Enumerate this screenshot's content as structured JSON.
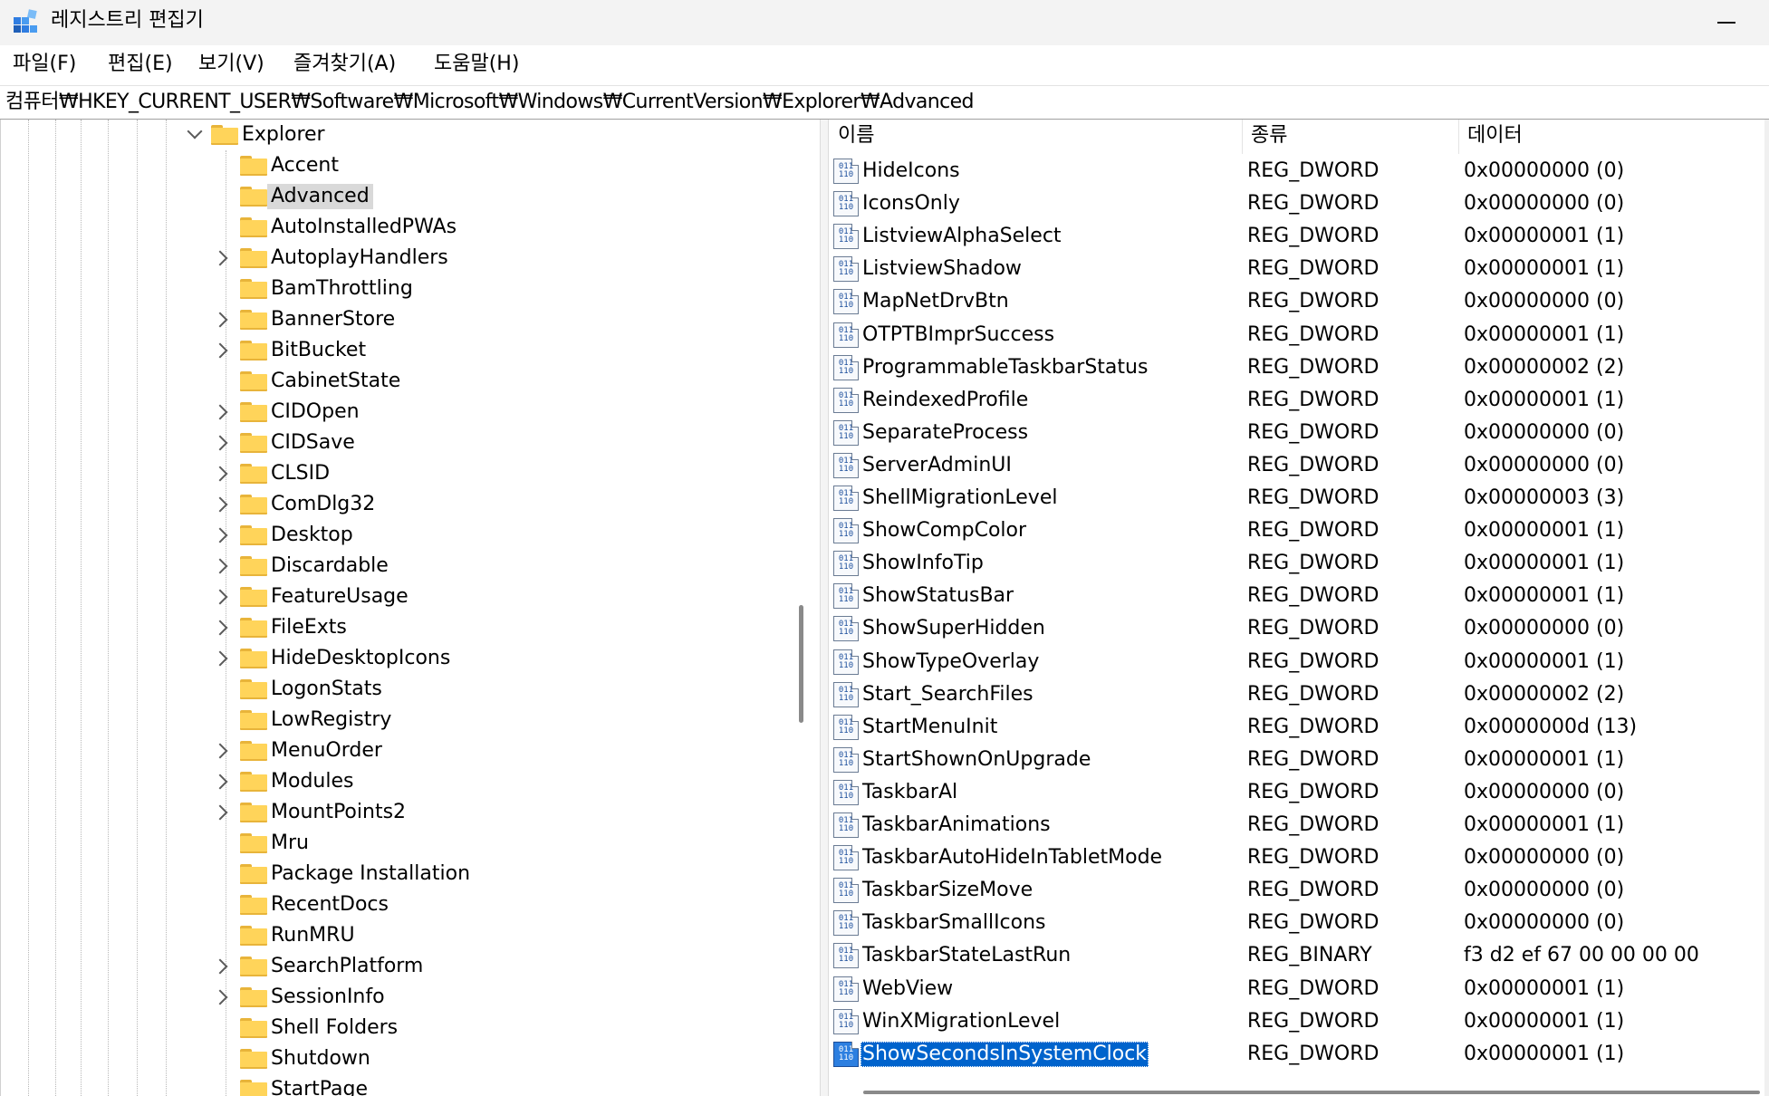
{
  "window": {
    "title": "레지스트리 편집기",
    "minimize_icon": "minimize-icon"
  },
  "menu": [
    {
      "label": "파일(F)"
    },
    {
      "label": "편집(E)"
    },
    {
      "label": "보기(V)"
    },
    {
      "label": "즐겨찾기(A)"
    },
    {
      "label": "도움말(H)"
    }
  ],
  "address": {
    "path": "컴퓨터₩HKEY_CURRENT_USER₩Software₩Microsoft₩Windows₩CurrentVersion₩Explorer₩Advanced"
  },
  "tree": {
    "parent": {
      "label": "Explorer",
      "expanded": true
    },
    "selected": "Advanced",
    "children": [
      {
        "label": "Accent",
        "has_children": false
      },
      {
        "label": "Advanced",
        "has_children": false
      },
      {
        "label": "AutoInstalledPWAs",
        "has_children": false
      },
      {
        "label": "AutoplayHandlers",
        "has_children": true
      },
      {
        "label": "BamThrottling",
        "has_children": false
      },
      {
        "label": "BannerStore",
        "has_children": true
      },
      {
        "label": "BitBucket",
        "has_children": true
      },
      {
        "label": "CabinetState",
        "has_children": false
      },
      {
        "label": "CIDOpen",
        "has_children": true
      },
      {
        "label": "CIDSave",
        "has_children": true
      },
      {
        "label": "CLSID",
        "has_children": true
      },
      {
        "label": "ComDlg32",
        "has_children": true
      },
      {
        "label": "Desktop",
        "has_children": true
      },
      {
        "label": "Discardable",
        "has_children": true
      },
      {
        "label": "FeatureUsage",
        "has_children": true
      },
      {
        "label": "FileExts",
        "has_children": true
      },
      {
        "label": "HideDesktopIcons",
        "has_children": true
      },
      {
        "label": "LogonStats",
        "has_children": false
      },
      {
        "label": "LowRegistry",
        "has_children": false
      },
      {
        "label": "MenuOrder",
        "has_children": true
      },
      {
        "label": "Modules",
        "has_children": true
      },
      {
        "label": "MountPoints2",
        "has_children": true
      },
      {
        "label": "Mru",
        "has_children": false
      },
      {
        "label": "Package Installation",
        "has_children": false
      },
      {
        "label": "RecentDocs",
        "has_children": false
      },
      {
        "label": "RunMRU",
        "has_children": false
      },
      {
        "label": "SearchPlatform",
        "has_children": true
      },
      {
        "label": "SessionInfo",
        "has_children": true
      },
      {
        "label": "Shell Folders",
        "has_children": false
      },
      {
        "label": "Shutdown",
        "has_children": false
      },
      {
        "label": "StartPage",
        "has_children": false
      }
    ]
  },
  "list": {
    "columns": {
      "name": "이름",
      "type": "종류",
      "data": "데이터"
    },
    "icon_text": [
      "011",
      "110"
    ],
    "selected": "ShowSecondsInSystemClock",
    "rows": [
      {
        "name": "HideIcons",
        "type": "REG_DWORD",
        "data": "0x00000000 (0)"
      },
      {
        "name": "IconsOnly",
        "type": "REG_DWORD",
        "data": "0x00000000 (0)"
      },
      {
        "name": "ListviewAlphaSelect",
        "type": "REG_DWORD",
        "data": "0x00000001 (1)"
      },
      {
        "name": "ListviewShadow",
        "type": "REG_DWORD",
        "data": "0x00000001 (1)"
      },
      {
        "name": "MapNetDrvBtn",
        "type": "REG_DWORD",
        "data": "0x00000000 (0)"
      },
      {
        "name": "OTPTBImprSuccess",
        "type": "REG_DWORD",
        "data": "0x00000001 (1)"
      },
      {
        "name": "ProgrammableTaskbarStatus",
        "type": "REG_DWORD",
        "data": "0x00000002 (2)"
      },
      {
        "name": "ReindexedProfile",
        "type": "REG_DWORD",
        "data": "0x00000001 (1)"
      },
      {
        "name": "SeparateProcess",
        "type": "REG_DWORD",
        "data": "0x00000000 (0)"
      },
      {
        "name": "ServerAdminUI",
        "type": "REG_DWORD",
        "data": "0x00000000 (0)"
      },
      {
        "name": "ShellMigrationLevel",
        "type": "REG_DWORD",
        "data": "0x00000003 (3)"
      },
      {
        "name": "ShowCompColor",
        "type": "REG_DWORD",
        "data": "0x00000001 (1)"
      },
      {
        "name": "ShowInfoTip",
        "type": "REG_DWORD",
        "data": "0x00000001 (1)"
      },
      {
        "name": "ShowStatusBar",
        "type": "REG_DWORD",
        "data": "0x00000001 (1)"
      },
      {
        "name": "ShowSuperHidden",
        "type": "REG_DWORD",
        "data": "0x00000000 (0)"
      },
      {
        "name": "ShowTypeOverlay",
        "type": "REG_DWORD",
        "data": "0x00000001 (1)"
      },
      {
        "name": "Start_SearchFiles",
        "type": "REG_DWORD",
        "data": "0x00000002 (2)"
      },
      {
        "name": "StartMenuInit",
        "type": "REG_DWORD",
        "data": "0x0000000d (13)"
      },
      {
        "name": "StartShownOnUpgrade",
        "type": "REG_DWORD",
        "data": "0x00000001 (1)"
      },
      {
        "name": "TaskbarAl",
        "type": "REG_DWORD",
        "data": "0x00000000 (0)"
      },
      {
        "name": "TaskbarAnimations",
        "type": "REG_DWORD",
        "data": "0x00000001 (1)"
      },
      {
        "name": "TaskbarAutoHideInTabletMode",
        "type": "REG_DWORD",
        "data": "0x00000000 (0)"
      },
      {
        "name": "TaskbarSizeMove",
        "type": "REG_DWORD",
        "data": "0x00000000 (0)"
      },
      {
        "name": "TaskbarSmallIcons",
        "type": "REG_DWORD",
        "data": "0x00000000 (0)"
      },
      {
        "name": "TaskbarStateLastRun",
        "type": "REG_BINARY",
        "data": "f3 d2 ef 67 00 00 00 00"
      },
      {
        "name": "WebView",
        "type": "REG_DWORD",
        "data": "0x00000001 (1)"
      },
      {
        "name": "WinXMigrationLevel",
        "type": "REG_DWORD",
        "data": "0x00000001 (1)"
      },
      {
        "name": "ShowSecondsInSystemClock",
        "type": "REG_DWORD",
        "data": "0x00000001 (1)"
      }
    ]
  },
  "colors": {
    "selection_blue": "#0063cc",
    "folder_yellow": "#ffd45a",
    "tree_selection": "#d9d9d9"
  }
}
